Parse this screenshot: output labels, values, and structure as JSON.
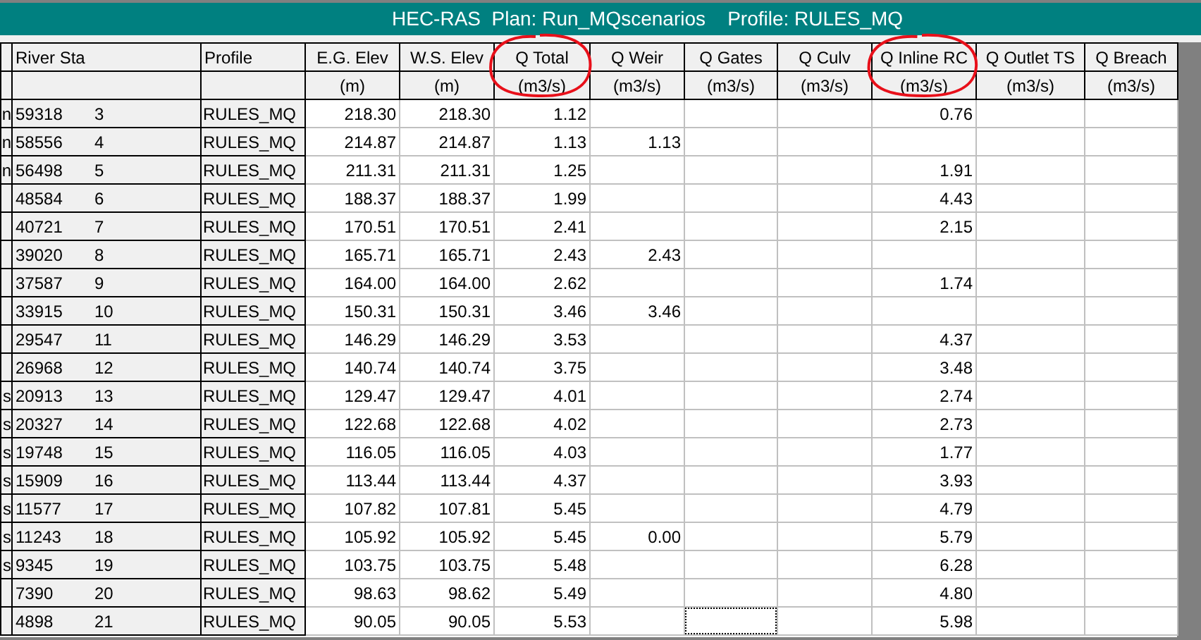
{
  "window": {
    "title": "HEC-RAS  Plan: Run_MQscenarios    Profile: RULES_MQ"
  },
  "table": {
    "columns": [
      {
        "label": "River Sta",
        "circled": false
      },
      {
        "label": "Profile",
        "circled": false
      },
      {
        "label": "E.G. Elev",
        "unit": "(m)",
        "circled": false
      },
      {
        "label": "W.S. Elev",
        "unit": "(m)",
        "circled": false
      },
      {
        "label": "Q Total",
        "unit": "(m3/s)",
        "circled": true
      },
      {
        "label": "Q Weir",
        "unit": "(m3/s)",
        "circled": false
      },
      {
        "label": "Q Gates",
        "unit": "(m3/s)",
        "circled": false
      },
      {
        "label": "Q Culv",
        "unit": "(m3/s)",
        "circled": false
      },
      {
        "label": "Q Inline RC",
        "unit": "(m3/s)",
        "circled": true
      },
      {
        "label": "Q Outlet TS",
        "unit": "(m3/s)",
        "circled": false
      },
      {
        "label": "Q Breach",
        "unit": "(m3/s)",
        "circled": false
      }
    ],
    "rows": [
      {
        "column_1": "n",
        "river_sta": [
          "59318",
          "3"
        ],
        "profile": "RULES_MQ",
        "eg_elev": "218.30",
        "ws_elev": "218.30",
        "q_total": "1.12",
        "q_inline_rc": "0.76",
        "gates_focused": false
      },
      {
        "column_1": "n",
        "river_sta": [
          "58556",
          "4"
        ],
        "profile": "RULES_MQ",
        "eg_elev": "214.87",
        "ws_elev": "214.87",
        "q_total": "1.13",
        "q_weir": "1.13",
        "gates_focused": false
      },
      {
        "column_1": "n",
        "river_sta": [
          "56498",
          "5"
        ],
        "profile": "RULES_MQ",
        "eg_elev": "211.31",
        "ws_elev": "211.31",
        "q_total": "1.25",
        "q_inline_rc": "1.91",
        "gates_focused": false
      },
      {
        "river_sta": [
          "48584",
          "6"
        ],
        "profile": "RULES_MQ",
        "eg_elev": "188.37",
        "ws_elev": "188.37",
        "q_total": "1.99",
        "q_inline_rc": "4.43",
        "gates_focused": false
      },
      {
        "river_sta": [
          "40721",
          "7"
        ],
        "profile": "RULES_MQ",
        "eg_elev": "170.51",
        "ws_elev": "170.51",
        "q_total": "2.41",
        "q_inline_rc": "2.15",
        "gates_focused": false
      },
      {
        "river_sta": [
          "39020",
          "8"
        ],
        "profile": "RULES_MQ",
        "eg_elev": "165.71",
        "ws_elev": "165.71",
        "q_total": "2.43",
        "q_weir": "2.43",
        "gates_focused": false
      },
      {
        "river_sta": [
          "37587",
          "9"
        ],
        "profile": "RULES_MQ",
        "eg_elev": "164.00",
        "ws_elev": "164.00",
        "q_total": "2.62",
        "q_inline_rc": "1.74",
        "gates_focused": false
      },
      {
        "river_sta": [
          "33915",
          "10"
        ],
        "profile": "RULES_MQ",
        "eg_elev": "150.31",
        "ws_elev": "150.31",
        "q_total": "3.46",
        "q_weir": "3.46",
        "gates_focused": false
      },
      {
        "river_sta": [
          "29547",
          "11"
        ],
        "profile": "RULES_MQ",
        "eg_elev": "146.29",
        "ws_elev": "146.29",
        "q_total": "3.53",
        "q_inline_rc": "4.37",
        "gates_focused": false
      },
      {
        "river_sta": [
          "26968",
          "12"
        ],
        "profile": "RULES_MQ",
        "eg_elev": "140.74",
        "ws_elev": "140.74",
        "q_total": "3.75",
        "q_inline_rc": "3.48",
        "gates_focused": false
      },
      {
        "column_1": "s",
        "river_sta": [
          "20913",
          "13"
        ],
        "profile": "RULES_MQ",
        "eg_elev": "129.47",
        "ws_elev": "129.47",
        "q_total": "4.01",
        "q_inline_rc": "2.74",
        "gates_focused": false
      },
      {
        "column_1": "s",
        "river_sta": [
          "20327",
          "14"
        ],
        "profile": "RULES_MQ",
        "eg_elev": "122.68",
        "ws_elev": "122.68",
        "q_total": "4.02",
        "q_inline_rc": "2.73",
        "gates_focused": false
      },
      {
        "column_1": "s",
        "river_sta": [
          "19748",
          "15"
        ],
        "profile": "RULES_MQ",
        "eg_elev": "116.05",
        "ws_elev": "116.05",
        "q_total": "4.03",
        "q_inline_rc": "1.77",
        "gates_focused": false
      },
      {
        "column_1": "s",
        "river_sta": [
          "15909",
          "16"
        ],
        "profile": "RULES_MQ",
        "eg_elev": "113.44",
        "ws_elev": "113.44",
        "q_total": "4.37",
        "q_inline_rc": "3.93",
        "gates_focused": false
      },
      {
        "column_1": "s",
        "river_sta": [
          "11577",
          "17"
        ],
        "profile": "RULES_MQ",
        "eg_elev": "107.82",
        "ws_elev": "107.81",
        "q_total": "5.45",
        "q_inline_rc": "4.79",
        "gates_focused": false
      },
      {
        "column_1": "s",
        "river_sta": [
          "11243",
          "18"
        ],
        "profile": "RULES_MQ",
        "eg_elev": "105.92",
        "ws_elev": "105.92",
        "q_total": "5.45",
        "q_weir": "0.00",
        "q_inline_rc": "5.79",
        "gates_focused": false
      },
      {
        "column_1": "s",
        "river_sta": [
          "9345",
          "19"
        ],
        "profile": "RULES_MQ",
        "eg_elev": "103.75",
        "ws_elev": "103.75",
        "q_total": "5.48",
        "q_inline_rc": "6.28",
        "gates_focused": false
      },
      {
        "river_sta": [
          "7390",
          "20"
        ],
        "profile": "RULES_MQ",
        "eg_elev": "98.63",
        "ws_elev": "98.62",
        "q_total": "5.49",
        "q_inline_rc": "4.80",
        "gates_focused": false
      },
      {
        "river_sta": [
          "4898",
          "21"
        ],
        "profile": "RULES_MQ",
        "eg_elev": "90.05",
        "ws_elev": "90.05",
        "q_total": "5.53",
        "q_inline_rc": "5.98",
        "gates_focused": true
      }
    ]
  }
}
